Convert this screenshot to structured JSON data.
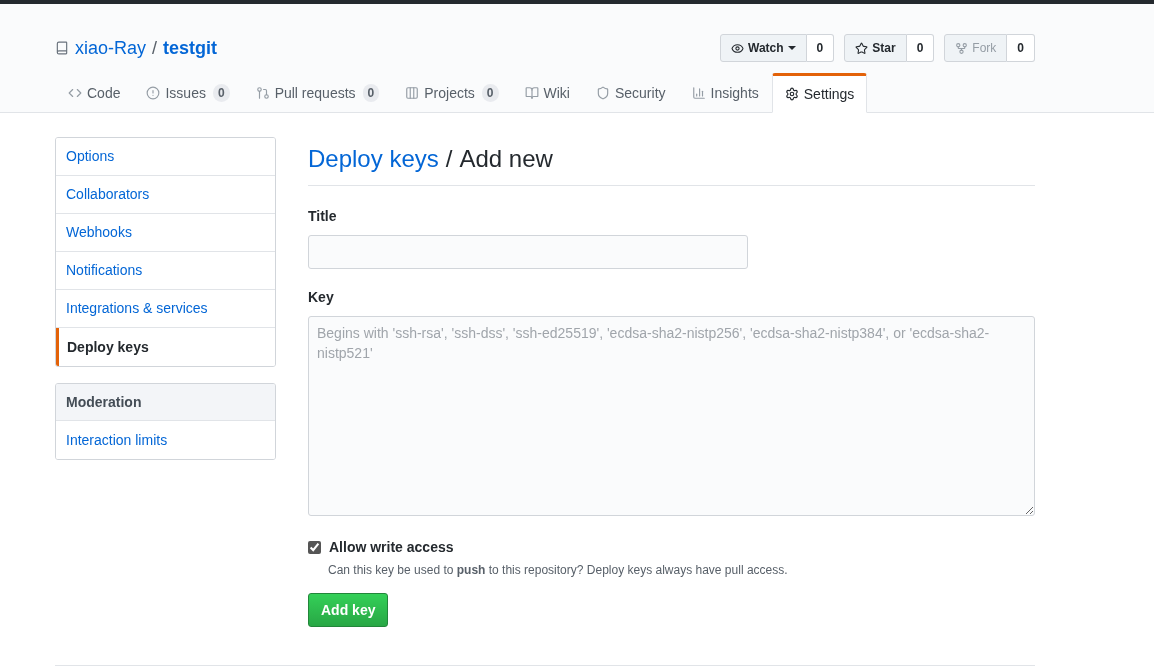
{
  "repo": {
    "owner": "xiao-Ray",
    "separator": "/",
    "name": "testgit"
  },
  "actions": [
    {
      "label": "Watch",
      "count": "0",
      "dropdown": true,
      "disabled": false
    },
    {
      "label": "Star",
      "count": "0",
      "dropdown": false,
      "disabled": false
    },
    {
      "label": "Fork",
      "count": "0",
      "dropdown": false,
      "disabled": true
    }
  ],
  "tabs": [
    {
      "label": "Code",
      "selected": false
    },
    {
      "label": "Issues",
      "count": "0",
      "selected": false
    },
    {
      "label": "Pull requests",
      "count": "0",
      "selected": false
    },
    {
      "label": "Projects",
      "count": "0",
      "selected": false
    },
    {
      "label": "Wiki",
      "selected": false
    },
    {
      "label": "Security",
      "selected": false
    },
    {
      "label": "Insights",
      "selected": false
    },
    {
      "label": "Settings",
      "selected": true
    }
  ],
  "sidebar": {
    "menu": [
      {
        "label": "Options",
        "selected": false
      },
      {
        "label": "Collaborators",
        "selected": false
      },
      {
        "label": "Webhooks",
        "selected": false
      },
      {
        "label": "Notifications",
        "selected": false
      },
      {
        "label": "Integrations & services",
        "selected": false
      },
      {
        "label": "Deploy keys",
        "selected": true
      }
    ],
    "moderation": {
      "heading": "Moderation",
      "items": [
        {
          "label": "Interaction limits",
          "selected": false
        }
      ]
    }
  },
  "form": {
    "breadcrumb": "Deploy keys",
    "separator": "/",
    "title": "Add new",
    "title_label": "Title",
    "key_label": "Key",
    "key_placeholder": "Begins with 'ssh-rsa', 'ssh-dss', 'ssh-ed25519', 'ecdsa-sha2-nistp256', 'ecdsa-sha2-nistp384', or 'ecdsa-sha2-nistp521'",
    "write_access": {
      "label": "Allow write access",
      "checked": true,
      "note": "Can this key be used to **push** to this repository? Deploy keys always have pull access."
    },
    "submit": "Add key"
  }
}
